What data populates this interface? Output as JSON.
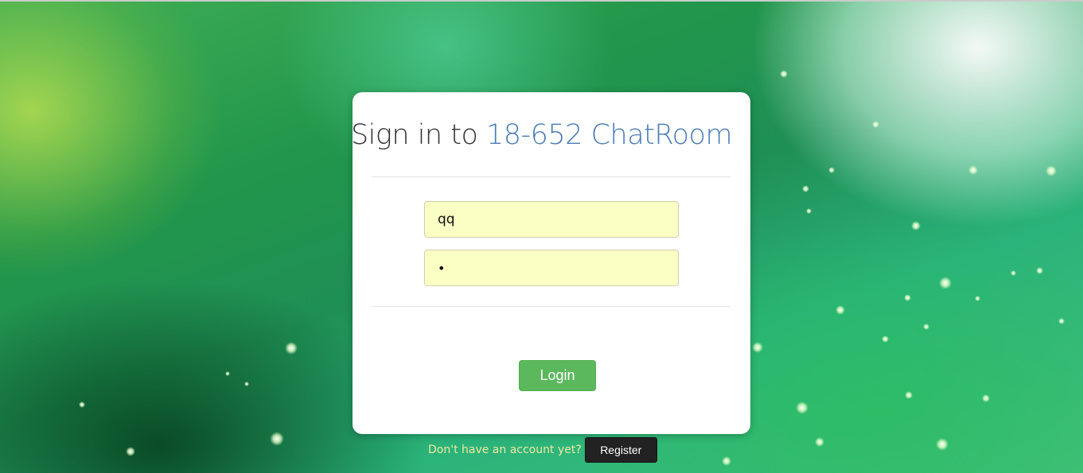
{
  "page": {
    "title_prefix": "Sign in to ",
    "title_brand": "18-652 ChatRoom"
  },
  "form": {
    "username_value": "qq",
    "password_value": "•",
    "login_label": "Login"
  },
  "footer": {
    "prompt_text": "Don't have an account yet?",
    "register_label": "Register"
  },
  "colors": {
    "brand": "#4a7bb7",
    "login_button": "#5cb85c",
    "input_autofill": "#faffc4"
  }
}
